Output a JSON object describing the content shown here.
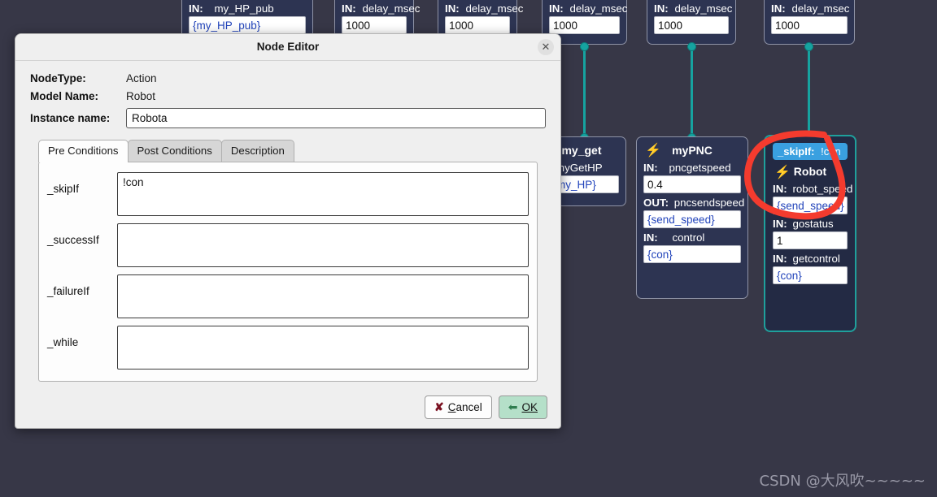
{
  "dialog": {
    "title": "Node Editor",
    "close_icon": "close-icon",
    "fields": {
      "nodetype_label": "NodeType:",
      "nodetype_value": "Action",
      "model_label": "Model Name:",
      "model_value": "Robot",
      "instance_label": "Instance name:",
      "instance_value": "Robota",
      "instance_placeholder": "Instance name"
    },
    "tabs": [
      {
        "label": "Pre Conditions",
        "active": true
      },
      {
        "label": "Post Conditions",
        "active": false
      },
      {
        "label": "Description",
        "active": false
      }
    ],
    "conditions": [
      {
        "label": "_skipIf",
        "value": "!con",
        "placeholder": ""
      },
      {
        "label": "_successIf",
        "value": "",
        "placeholder": ""
      },
      {
        "label": "_failureIf",
        "value": "",
        "placeholder": ""
      },
      {
        "label": "_while",
        "value": "",
        "placeholder": ""
      }
    ],
    "buttons": {
      "cancel": "Cancel",
      "cancel_accel": "C",
      "ok": "OK",
      "ok_accel": "O",
      "cancel_icon": "x-mark-icon",
      "ok_icon": "check-arrow-icon"
    }
  },
  "canvas": {
    "background_color": "#373747",
    "node_color": "#2d3452",
    "link_color": "#16a3a0",
    "selected_border_color": "#1fa09c",
    "chip_color": "#3aa0e0",
    "annotation_color": "#f03030",
    "top_nodes": [
      {
        "port_prefix": "IN:",
        "port_name": "my_HP_pub",
        "value": "{my_HP_pub}"
      },
      {
        "port_prefix": "IN:",
        "port_name": "delay_msec",
        "value": "1000"
      },
      {
        "port_prefix": "IN:",
        "port_name": "delay_msec",
        "value": "1000"
      },
      {
        "port_prefix": "IN:",
        "port_name": "delay_msec",
        "value": "1000"
      },
      {
        "port_prefix": "IN:",
        "port_name": "delay_msec",
        "value": "1000"
      },
      {
        "port_prefix": "IN:",
        "port_name": "delay_msec",
        "value": "1000"
      }
    ],
    "node_myget": {
      "title": "my_get",
      "bolt_icon": "bolt-icon",
      "port_label": "myGetHP",
      "value": "my_HP}"
    },
    "node_mypnc": {
      "title": "myPNC",
      "bolt_icon": "bolt-icon",
      "ports": [
        {
          "dir": "IN:",
          "name": "pncgetspeed",
          "value": "0.4",
          "is_var": false
        },
        {
          "dir": "OUT:",
          "name": "pncsendspeed",
          "value": "{send_speed}",
          "is_var": true
        },
        {
          "dir": "IN:",
          "name": "control",
          "value": "{con}",
          "is_var": true
        }
      ]
    },
    "node_robot": {
      "skipif_label": "_skipIf:",
      "skipif_value": "!con",
      "title": "Robot",
      "bolt_icon": "bolt-icon",
      "ports": [
        {
          "dir": "IN:",
          "name": "robot_speed",
          "value": "{send_speed}",
          "is_var": true
        },
        {
          "dir": "IN:",
          "name": "gostatus",
          "value": "1",
          "is_var": false
        },
        {
          "dir": "IN:",
          "name": "getcontrol",
          "value": "{con}",
          "is_var": true
        }
      ]
    }
  },
  "watermark": "CSDN @大风吹~~~~~"
}
